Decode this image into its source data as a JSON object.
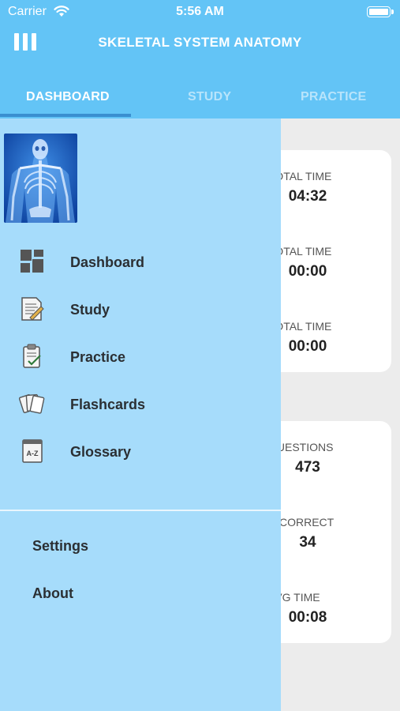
{
  "status_bar": {
    "carrier": "Carrier",
    "time": "5:56 AM"
  },
  "header": {
    "title": "SKELETAL SYSTEM ANATOMY"
  },
  "tabs": [
    {
      "label": "DASHBOARD"
    },
    {
      "label": "STUDY"
    },
    {
      "label": "PRACTICE"
    }
  ],
  "cards": {
    "time": [
      {
        "label": "TOTAL TIME",
        "value": "04:32"
      },
      {
        "label": "TOTAL TIME",
        "value": "00:00"
      },
      {
        "label": "TOTAL TIME",
        "value": "00:00"
      }
    ],
    "questions": [
      {
        "label": "QUESTIONS",
        "value": "473"
      },
      {
        "label": "INCORRECT",
        "value": "34"
      },
      {
        "label": "AVG TIME",
        "value": "00:08"
      }
    ]
  },
  "drawer": {
    "menu": [
      {
        "label": "Dashboard",
        "icon": "dashboard-icon"
      },
      {
        "label": "Study",
        "icon": "study-icon"
      },
      {
        "label": "Practice",
        "icon": "practice-icon"
      },
      {
        "label": "Flashcards",
        "icon": "flashcards-icon"
      },
      {
        "label": "Glossary",
        "icon": "glossary-icon"
      }
    ],
    "bottom": [
      {
        "label": "Settings"
      },
      {
        "label": "About"
      }
    ]
  },
  "colors": {
    "header": "#63c4f6",
    "drawer": "#a6dcfb",
    "tab_indicator": "#3a8fd0"
  }
}
